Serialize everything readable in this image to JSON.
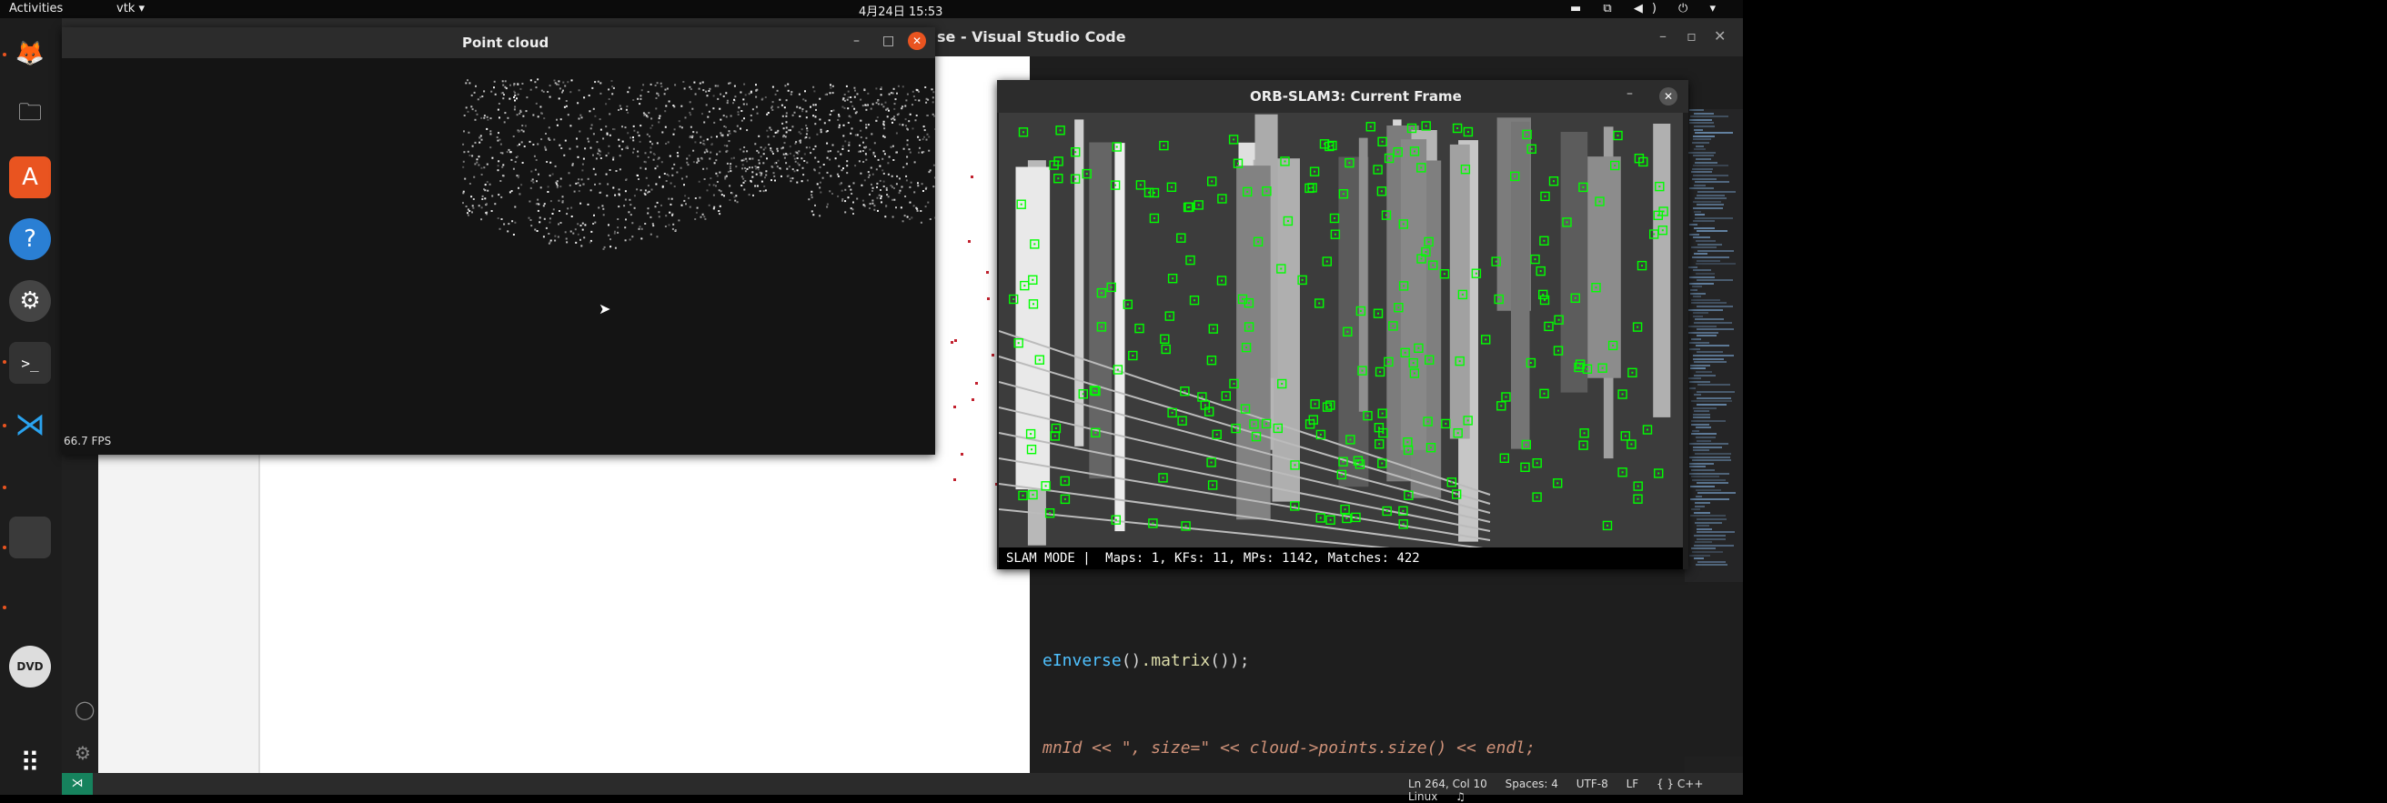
{
  "topbar": {
    "activities": "Activities",
    "app_menu": "vtk ▾",
    "clock": "4月24日  15:53",
    "tray": "▬ ⧉ ◀) ⏻ ▾"
  },
  "dock": {
    "items": [
      {
        "icon": "firefox-icon",
        "glyph": "🦊"
      },
      {
        "icon": "files-icon",
        "glyph": "🗀"
      },
      {
        "icon": "software-center-icon",
        "glyph": "A"
      },
      {
        "icon": "help-icon",
        "glyph": "?"
      },
      {
        "icon": "settings-icon",
        "glyph": "⚙"
      },
      {
        "icon": "terminal-icon",
        "glyph": ">_"
      },
      {
        "icon": "vscode-icon",
        "glyph": "⋊"
      },
      {
        "icon": "dvd-icon",
        "glyph": "DVD"
      },
      {
        "icon": "app-grid-icon",
        "glyph": "⠿"
      }
    ],
    "accent": "#e95420"
  },
  "vscode": {
    "title": "se - Visual Studio Code",
    "code_line1": {
      "a": "eInverse",
      "b": "()",
      "c": ".matrix",
      "d": "());"
    },
    "code_line2": {
      "a": "mnId << \", size=\" << cloud->points.size() << endl;"
    },
    "status": {
      "position": "Ln 264, Col 10",
      "spaces": "Spaces: 4",
      "encoding": "UTF-8",
      "eol": "LF",
      "language": "{ } C++",
      "os": "Linux"
    },
    "remote_label": "⋊"
  },
  "pointcloud_window": {
    "title": "Point cloud",
    "fps": "66.7 FPS"
  },
  "orb_window": {
    "title": "ORB-SLAM3: Current Frame",
    "mode": "SLAM MODE |",
    "stats": "Maps: 1, KFs: 11, MPs: 1142, Matches: 422",
    "feature_color": "#00ff00"
  }
}
